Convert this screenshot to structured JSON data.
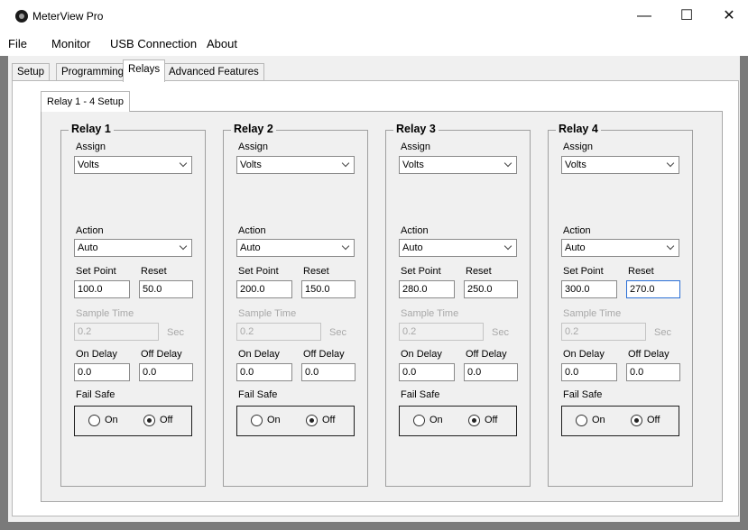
{
  "window": {
    "title": "MeterView Pro",
    "minimize_glyph": "—",
    "maximize_glyph": "☐",
    "close_glyph": "✕"
  },
  "menu": [
    "File",
    "Monitor",
    "USB Connection",
    "About"
  ],
  "tabs": [
    "Setup",
    "Programming",
    "Relays",
    "Advanced Features"
  ],
  "active_tab": "Relays",
  "subtab": "Relay 1 - 4 Setup",
  "labels": {
    "assign": "Assign",
    "action": "Action",
    "set_point": "Set Point",
    "reset": "Reset",
    "sample_time": "Sample Time",
    "sec": "Sec",
    "on_delay": "On Delay",
    "off_delay": "Off Delay",
    "fail_safe": "Fail Safe",
    "on": "On",
    "off": "Off"
  },
  "relays": [
    {
      "title": "Relay 1",
      "assign": "Volts",
      "action": "Auto",
      "set_point": "100.0",
      "reset": "50.0",
      "sample_time": "0.2",
      "on_delay": "0.0",
      "off_delay": "0.0",
      "fail_safe": "Off"
    },
    {
      "title": "Relay 2",
      "assign": "Volts",
      "action": "Auto",
      "set_point": "200.0",
      "reset": "150.0",
      "sample_time": "0.2",
      "on_delay": "0.0",
      "off_delay": "0.0",
      "fail_safe": "Off"
    },
    {
      "title": "Relay 3",
      "assign": "Volts",
      "action": "Auto",
      "set_point": "280.0",
      "reset": "250.0",
      "sample_time": "0.2",
      "on_delay": "0.0",
      "off_delay": "0.0",
      "fail_safe": "Off"
    },
    {
      "title": "Relay 4",
      "assign": "Volts",
      "action": "Auto",
      "set_point": "300.0",
      "reset": "270.0",
      "sample_time": "0.2",
      "on_delay": "0.0",
      "off_delay": "0.0",
      "fail_safe": "Off"
    }
  ],
  "focused_field": "relays.3.reset"
}
